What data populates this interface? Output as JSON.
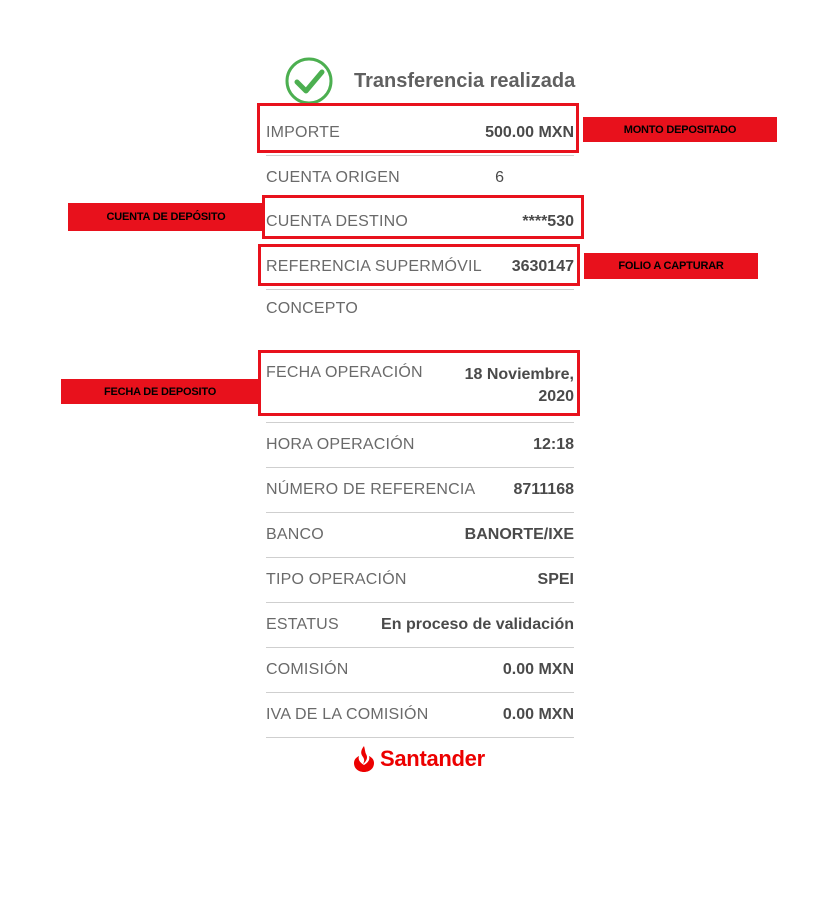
{
  "header": {
    "title": "Transferencia realizada"
  },
  "rows": [
    {
      "label": "IMPORTE",
      "value": "500.00 MXN"
    },
    {
      "label": "CUENTA ORIGEN",
      "value": "6"
    },
    {
      "label": "CUENTA DESTINO",
      "value": "****530"
    },
    {
      "label": "REFERENCIA SUPERMÓVIL",
      "value": "3630147"
    },
    {
      "label": "CONCEPTO",
      "value": ""
    },
    {
      "label": "FECHA OPERACIÓN",
      "value": "18 Noviembre, 2020"
    },
    {
      "label": "HORA OPERACIÓN",
      "value": "12:18"
    },
    {
      "label": "NÚMERO DE REFERENCIA",
      "value": "8711168"
    },
    {
      "label": "BANCO",
      "value": "BANORTE/IXE"
    },
    {
      "label": "TIPO OPERACIÓN",
      "value": "SPEI"
    },
    {
      "label": "ESTATUS",
      "value": "En proceso de validación"
    },
    {
      "label": "COMISIÓN",
      "value": "0.00 MXN"
    },
    {
      "label": "IVA DE LA COMISIÓN",
      "value": "0.00 MXN"
    }
  ],
  "annotations": {
    "monto": "MONTO DEPOSITADO",
    "cuenta": "CUENTA DE DEPÓSITO",
    "folio": "FOLIO A CAPTURAR",
    "fecha": "FECHA DE DEPOSITO"
  },
  "logo": {
    "text": "Santander"
  },
  "colors": {
    "accent_red": "#e8111c",
    "success_green": "#4caf50",
    "brand_red": "#ec0000"
  }
}
